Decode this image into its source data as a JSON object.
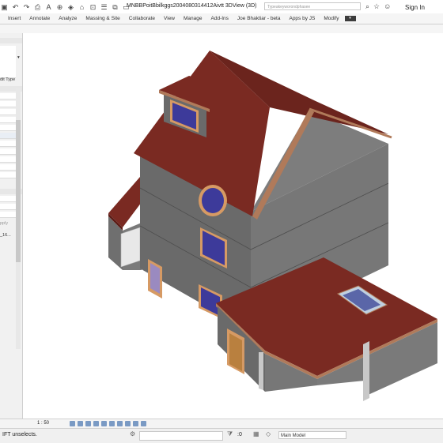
{
  "window": {
    "title": "MNBBPoitBbilkggs2004080314412Aivtt 3DView (3D)",
    "search_placeholder": "Typeakeyworondphasee",
    "sign_in": "Sign In"
  },
  "ribbon_tabs": [
    "Insert",
    "Annotate",
    "Analyze",
    "Massing & Site",
    "Collaborate",
    "View",
    "Manage",
    "Add-Ins",
    "Joe Bhaktiar - beta",
    "Apps by JS",
    "Modify"
  ],
  "properties_panel": {
    "edit_type": "dit Type",
    "apply": "pply",
    "project_browser_item": "_16..."
  },
  "view_control": {
    "scale": "1 : 50"
  },
  "status_bar": {
    "message": "IFT unselects.",
    "selection_count": ":0",
    "model": "Main Model"
  },
  "colors": {
    "roof": "#7a2a22",
    "roof_shadow": "#5e1e18",
    "fascia": "#b07a5a",
    "wall": "#6f6f6f",
    "wall_dark": "#555555",
    "window_glass": "#3d3a9a",
    "window_frame": "#d69a64"
  },
  "icons": [
    "save-icon",
    "undo-icon",
    "redo-icon",
    "print-icon",
    "text-icon",
    "3d-view-icon",
    "close-icon",
    "user-icon",
    "help-icon"
  ]
}
